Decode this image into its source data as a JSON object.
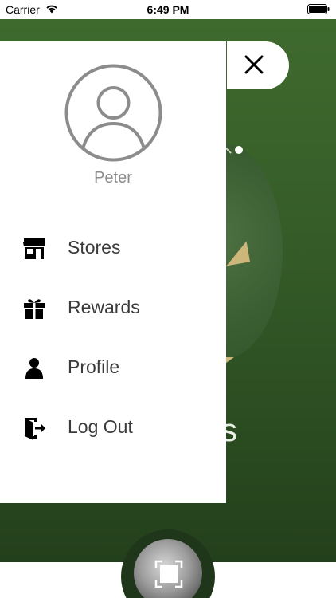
{
  "status_bar": {
    "carrier": "Carrier",
    "time": "6:49 PM",
    "wifi_icon": "wifi-icon",
    "battery_icon": "battery-icon"
  },
  "background": {
    "partial_text": "s",
    "primary_color": "#3f6a2e",
    "accent_color": "#cdb67a"
  },
  "drawer": {
    "user_name": "Peter",
    "avatar_icon": "user-circle-icon",
    "close_icon": "close-icon",
    "menu": [
      {
        "label": "Stores",
        "icon": "store-icon"
      },
      {
        "label": "Rewards",
        "icon": "gift-icon"
      },
      {
        "label": "Profile",
        "icon": "person-icon"
      },
      {
        "label": "Log Out",
        "icon": "logout-icon"
      }
    ]
  },
  "bottom": {
    "scan_icon": "scan-icon"
  }
}
